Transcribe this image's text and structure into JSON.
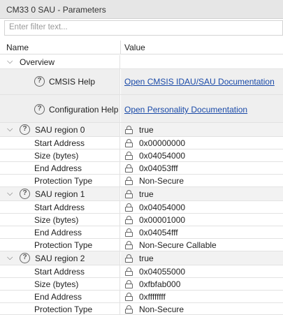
{
  "window": {
    "title": "CM33 0 SAU - Parameters"
  },
  "filter": {
    "placeholder": "Enter filter text..."
  },
  "columns": {
    "name": "Name",
    "value": "Value"
  },
  "overview": {
    "label": "Overview",
    "cmsis_help": {
      "label": "CMSIS Help",
      "link": "Open CMSIS IDAU/SAU Documentation"
    },
    "config_help": {
      "label": "Configuration Help",
      "link": "Open Personality Documentation"
    }
  },
  "regions": [
    {
      "label": "SAU region 0",
      "enabled": "true",
      "rows": [
        {
          "name": "Start Address",
          "value": "0x00000000"
        },
        {
          "name": "Size (bytes)",
          "value": "0x04054000"
        },
        {
          "name": "End Address",
          "value": "0x04053fff"
        },
        {
          "name": "Protection Type",
          "value": "Non-Secure"
        }
      ]
    },
    {
      "label": "SAU region 1",
      "enabled": "true",
      "rows": [
        {
          "name": "Start Address",
          "value": "0x04054000"
        },
        {
          "name": "Size (bytes)",
          "value": "0x00001000"
        },
        {
          "name": "End Address",
          "value": "0x04054fff"
        },
        {
          "name": "Protection Type",
          "value": "Non-Secure Callable"
        }
      ]
    },
    {
      "label": "SAU region 2",
      "enabled": "true",
      "rows": [
        {
          "name": "Start Address",
          "value": "0x04055000"
        },
        {
          "name": "Size (bytes)",
          "value": "0xfbfab000"
        },
        {
          "name": "End Address",
          "value": "0xffffffff"
        },
        {
          "name": "Protection Type",
          "value": "Non-Secure"
        }
      ]
    }
  ]
}
